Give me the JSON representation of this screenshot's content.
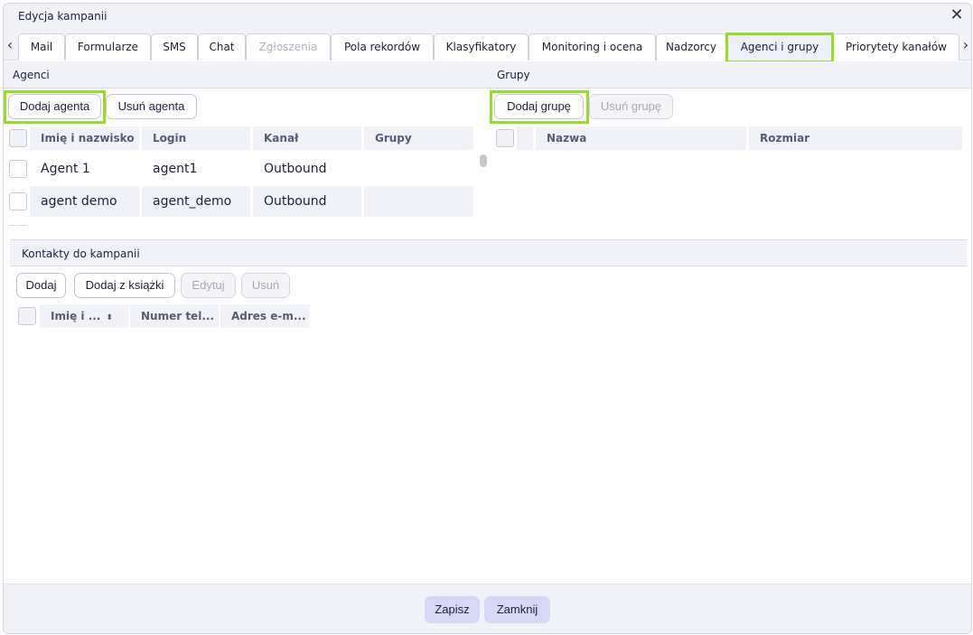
{
  "window": {
    "title": "Edycja kampanii",
    "close_icon": "close-icon"
  },
  "tabs": [
    {
      "label": "Mail",
      "disabled": false
    },
    {
      "label": "Formularze",
      "disabled": false
    },
    {
      "label": "SMS",
      "disabled": false
    },
    {
      "label": "Chat",
      "disabled": false
    },
    {
      "label": "Zgłoszenia",
      "disabled": true
    },
    {
      "label": "Pola rekordów",
      "disabled": false
    },
    {
      "label": "Klasyfikatory",
      "disabled": false
    },
    {
      "label": "Monitoring i ocena",
      "disabled": false
    },
    {
      "label": "Nadzorcy",
      "disabled": false
    },
    {
      "label": "Agenci i grupy",
      "disabled": false,
      "active": true
    },
    {
      "label": "Priorytety kanałów",
      "disabled": false
    }
  ],
  "tab_arrows": {
    "left": "‹",
    "right": "›"
  },
  "agents": {
    "header": "Agenci",
    "add_button": "Dodaj agenta",
    "remove_button": "Usuń agenta",
    "columns": [
      "Imię i nazwisko",
      "Login",
      "Kanał",
      "Grupy"
    ],
    "rows": [
      {
        "name": "Agent 1",
        "login": "agent1",
        "channel": "Outbound",
        "groups": ""
      },
      {
        "name": "agent demo",
        "login": "agent_demo",
        "channel": "Outbound",
        "groups": ""
      }
    ]
  },
  "groups": {
    "header": "Grupy",
    "add_button": "Dodaj grupę",
    "remove_button": "Usuń grupę",
    "columns": [
      "Nazwa",
      "Rozmiar"
    ]
  },
  "contacts": {
    "header": "Kontakty do kampanii",
    "buttons": {
      "add": "Dodaj",
      "add_from_book": "Dodaj z książki",
      "edit": "Edytuj",
      "remove": "Usuń"
    },
    "columns": [
      "Imię i ...",
      "Numer tel...",
      "Adres e-m..."
    ],
    "sort_icon": "sort-icon"
  },
  "footer": {
    "save": "Zapisz",
    "close": "Zamknij"
  },
  "colors": {
    "highlight": "#96dc28",
    "primary_button": "#d6d7f4",
    "header_bg": "#f1f2f8"
  }
}
